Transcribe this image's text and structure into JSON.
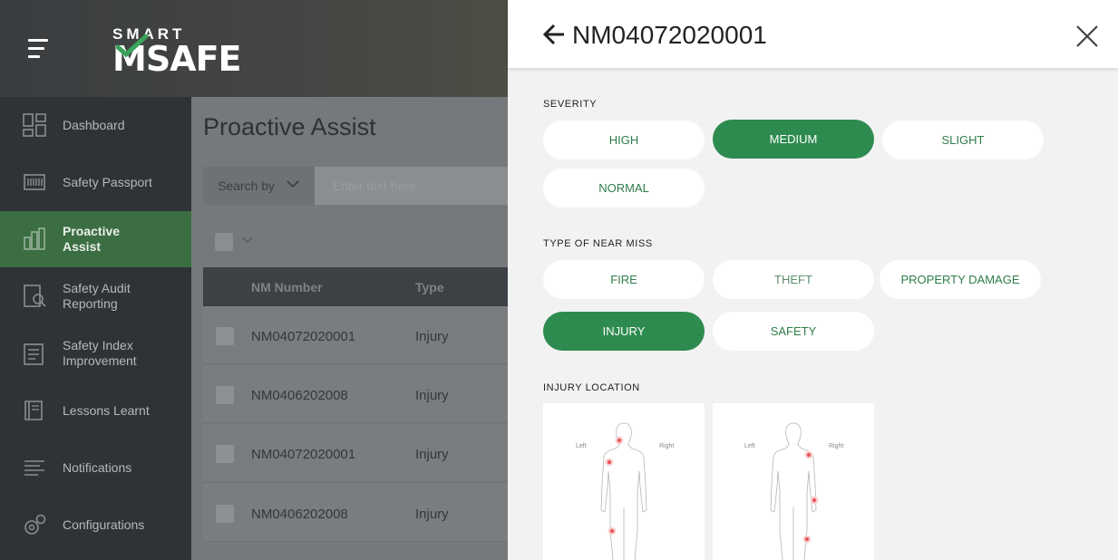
{
  "app": {
    "logo_top": "SMART",
    "logo_bottom": "MSAFE"
  },
  "sidebar": {
    "items": [
      {
        "label": "Dashboard",
        "icon": "dashboard-icon"
      },
      {
        "label": "Safety Passport",
        "icon": "passport-icon"
      },
      {
        "label": "Proactive Assist",
        "icon": "proactive-assist-icon",
        "active": true
      },
      {
        "label": "Safety Audit Reporting",
        "icon": "audit-icon"
      },
      {
        "label": "Safety Index Improvement",
        "icon": "index-icon"
      },
      {
        "label": "Lessons Learnt",
        "icon": "book-icon"
      },
      {
        "label": "Notifications",
        "icon": "notifications-icon"
      },
      {
        "label": "Configurations",
        "icon": "gears-icon"
      }
    ]
  },
  "main": {
    "title": "Proactive Assist",
    "search_by_label": "Search by",
    "search_placeholder": "Enter text here",
    "table": {
      "columns": [
        "NM Number",
        "Type"
      ],
      "rows": [
        {
          "nm_number": "NM04072020001",
          "type": "Injury"
        },
        {
          "nm_number": "NM0406202008",
          "type": "Injury"
        },
        {
          "nm_number": "NM04072020001",
          "type": "Injury"
        },
        {
          "nm_number": "NM0406202008",
          "type": "Injury"
        }
      ]
    }
  },
  "panel": {
    "title": "NM04072020001",
    "severity": {
      "label": "SEVERITY",
      "options": [
        "HIGH",
        "MEDIUM",
        "SLIGHT",
        "NORMAL"
      ],
      "selected": "MEDIUM"
    },
    "near_miss_type": {
      "label": "TYPE OF NEAR MISS",
      "options": [
        "FIRE",
        "THEFT",
        "PROPERTY DAMAGE",
        "INJURY",
        "SAFETY"
      ],
      "selected": "INJURY"
    },
    "injury_location": {
      "label": "INJURY LOCATION",
      "figures": [
        {
          "view": "front",
          "left_label": "Left",
          "right_label": "Right"
        },
        {
          "view": "back",
          "left_label": "Left",
          "right_label": "Right"
        }
      ]
    }
  },
  "colors": {
    "accent_green": "#2e8b4f",
    "sidebar_active": "#3b6e43",
    "marker_red": "#e8585b"
  }
}
